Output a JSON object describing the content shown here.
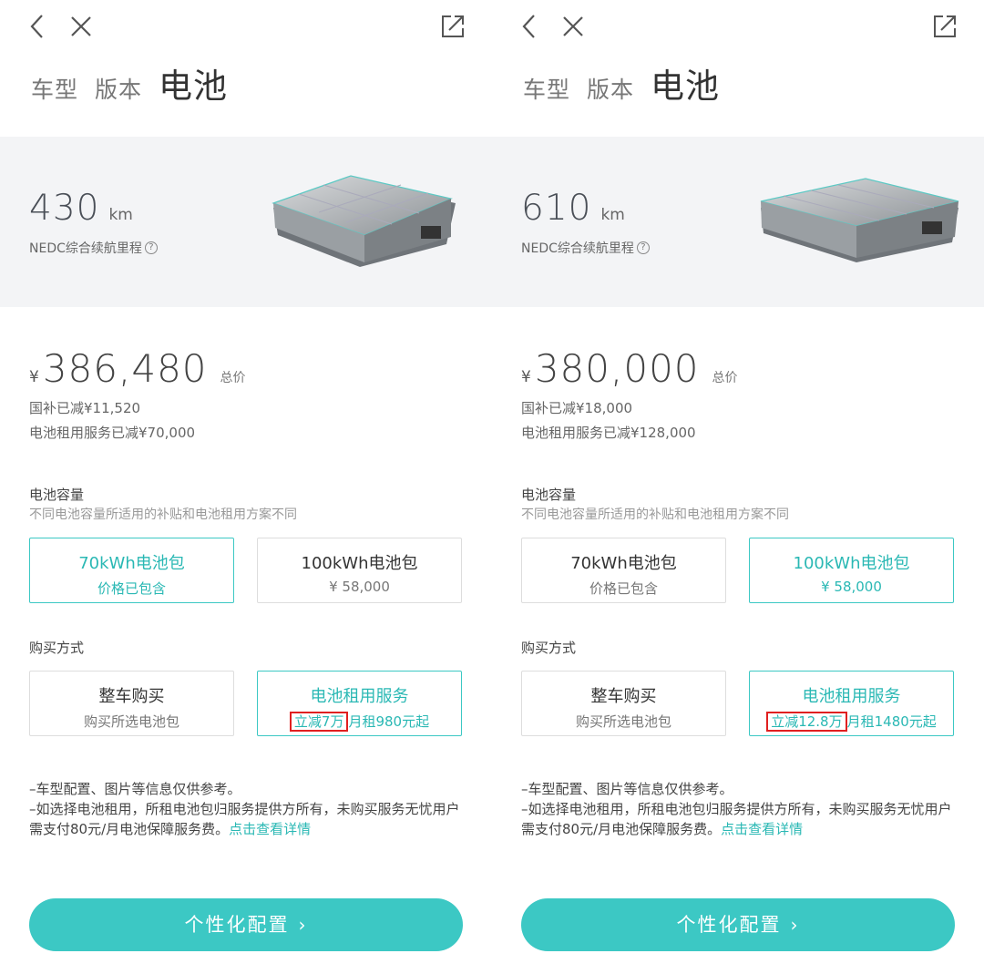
{
  "panels": [
    {
      "tabs": [
        "车型",
        "版本",
        "电池"
      ],
      "range": {
        "value": "430",
        "unit": "km",
        "label": "NEDC综合续航里程"
      },
      "price": {
        "currency": "¥",
        "value": "386,480",
        "suffix": "总价"
      },
      "subsidies": [
        "国补已减¥11,520",
        "电池租用服务已减¥70,000"
      ],
      "capacity": {
        "title": "电池容量",
        "subtitle": "不同电池容量所适用的补贴和电池租用方案不同",
        "options": [
          {
            "title": "70kWh电池包",
            "sub": "价格已包含",
            "selected": true
          },
          {
            "title": "100kWh电池包",
            "sub": "¥ 58,000",
            "selected": false
          }
        ]
      },
      "purchase": {
        "title": "购买方式",
        "options": [
          {
            "title": "整车购买",
            "sub": "购买所选电池包",
            "selected": false
          },
          {
            "title": "电池租用服务",
            "highlight": "立减7万",
            "sub": "月租980元起",
            "selected": true
          }
        ]
      },
      "notes": {
        "line1": "–车型配置、图片等信息仅供参考。",
        "line2": "–如选择电池租用，所租电池包归服务提供方所有，未购买服务无忧用户需支付80元/月电池保障服务费。",
        "link": "点击查看详情"
      },
      "cta": {
        "label": "个性化配置",
        "chevron": "›"
      }
    },
    {
      "tabs": [
        "车型",
        "版本",
        "电池"
      ],
      "range": {
        "value": "610",
        "unit": "km",
        "label": "NEDC综合续航里程"
      },
      "price": {
        "currency": "¥",
        "value": "380,000",
        "suffix": "总价"
      },
      "subsidies": [
        "国补已减¥18,000",
        "电池租用服务已减¥128,000"
      ],
      "capacity": {
        "title": "电池容量",
        "subtitle": "不同电池容量所适用的补贴和电池租用方案不同",
        "options": [
          {
            "title": "70kWh电池包",
            "sub": "价格已包含",
            "selected": false
          },
          {
            "title": "100kWh电池包",
            "sub": "¥ 58,000",
            "selected": true
          }
        ]
      },
      "purchase": {
        "title": "购买方式",
        "options": [
          {
            "title": "整车购买",
            "sub": "购买所选电池包",
            "selected": false
          },
          {
            "title": "电池租用服务",
            "highlight": "立减12.8万",
            "sub": "月租1480元起",
            "selected": true
          }
        ]
      },
      "notes": {
        "line1": "–车型配置、图片等信息仅供参考。",
        "line2": "–如选择电池租用，所租电池包归服务提供方所有，未购买服务无忧用户需支付80元/月电池保障服务费。",
        "link": "点击查看详情"
      },
      "cta": {
        "label": "个性化配置",
        "chevron": "›"
      }
    }
  ],
  "colors": {
    "accent": "#3cc8c4",
    "accent_text": "#2ab8b4",
    "highlight_border": "#e02020",
    "hero_bg": "#f3f4f6"
  },
  "icons": [
    "back-icon",
    "close-icon",
    "share-icon",
    "help-icon",
    "chevron-right-icon"
  ]
}
